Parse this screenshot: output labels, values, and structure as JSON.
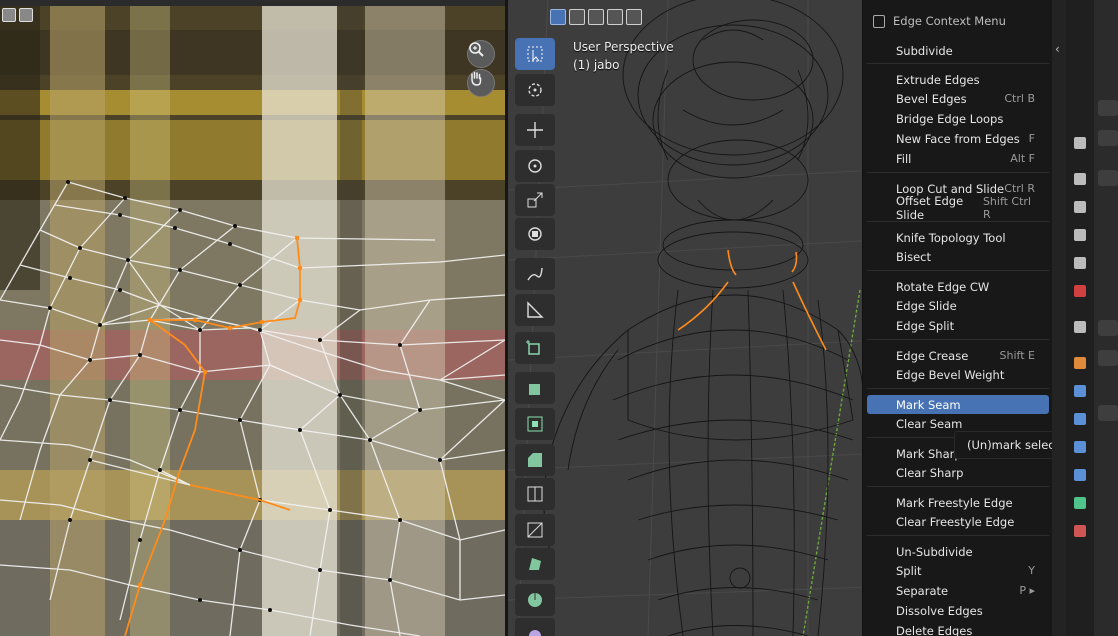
{
  "viewport": {
    "perspective_label": "User Perspective",
    "object_label": "(1) jabo"
  },
  "uv_editor": {
    "zoom_icon": "zoom-icon",
    "pan_icon": "hand-icon"
  },
  "toolbar": {
    "tools": [
      {
        "name": "select-box-icon",
        "active": true
      },
      {
        "name": "cursor-icon"
      },
      {
        "name": "move-icon"
      },
      {
        "name": "rotate-icon"
      },
      {
        "name": "scale-icon"
      },
      {
        "name": "transform-icon"
      },
      {
        "name": "annotate-icon"
      },
      {
        "name": "measure-icon"
      },
      {
        "name": "add-cube-icon"
      },
      {
        "name": "extrude-region-icon"
      },
      {
        "name": "inset-faces-icon"
      },
      {
        "name": "bevel-icon"
      },
      {
        "name": "loop-cut-icon"
      },
      {
        "name": "knife-icon"
      },
      {
        "name": "poly-build-icon"
      },
      {
        "name": "spin-icon"
      },
      {
        "name": "smooth-icon"
      }
    ]
  },
  "context_menu": {
    "title": "Edge Context Menu",
    "items": [
      {
        "label": "Subdivide",
        "shortcut": ""
      },
      {
        "label": "Extrude Edges",
        "shortcut": ""
      },
      {
        "label": "Bevel Edges",
        "shortcut": "Ctrl B"
      },
      {
        "label": "Bridge Edge Loops",
        "shortcut": ""
      },
      {
        "label": "New Face from Edges",
        "shortcut": "F"
      },
      {
        "label": "Fill",
        "shortcut": "Alt F"
      },
      {
        "label": "Loop Cut and Slide",
        "shortcut": "Ctrl R"
      },
      {
        "label": "Offset Edge Slide",
        "shortcut": "Shift Ctrl R"
      },
      {
        "label": "Knife Topology Tool",
        "shortcut": ""
      },
      {
        "label": "Bisect",
        "shortcut": ""
      },
      {
        "label": "Rotate Edge CW",
        "shortcut": ""
      },
      {
        "label": "Edge Slide",
        "shortcut": ""
      },
      {
        "label": "Edge Split",
        "shortcut": ""
      },
      {
        "label": "Edge Crease",
        "shortcut": "Shift E"
      },
      {
        "label": "Edge Bevel Weight",
        "shortcut": ""
      },
      {
        "label": "Mark Seam",
        "shortcut": "",
        "highlighted": true
      },
      {
        "label": "Clear Seam",
        "shortcut": ""
      },
      {
        "label": "Mark Sharp",
        "shortcut": ""
      },
      {
        "label": "Clear Sharp",
        "shortcut": ""
      },
      {
        "label": "Mark Freestyle Edge",
        "shortcut": ""
      },
      {
        "label": "Clear Freestyle Edge",
        "shortcut": ""
      },
      {
        "label": "Un-Subdivide",
        "shortcut": ""
      },
      {
        "label": "Split",
        "shortcut": "Y"
      },
      {
        "label": "Separate",
        "shortcut": "P ▸"
      },
      {
        "label": "Dissolve Edges",
        "shortcut": ""
      },
      {
        "label": "Delete Edges",
        "shortcut": ""
      }
    ],
    "tooltip": "(Un)mark selected edges as a"
  },
  "properties": {
    "tabs": [
      "tool-icon",
      "render-icon",
      "output-icon",
      "view-layer-icon",
      "scene-icon",
      "world-icon",
      "collection-icon",
      "object-icon",
      "modifier-icon",
      "particles-icon",
      "physics-icon",
      "constraints-icon",
      "data-icon",
      "material-icon"
    ],
    "colors": {
      "accent": "#4772b3",
      "selected_edge": "#ff8c1a"
    }
  }
}
